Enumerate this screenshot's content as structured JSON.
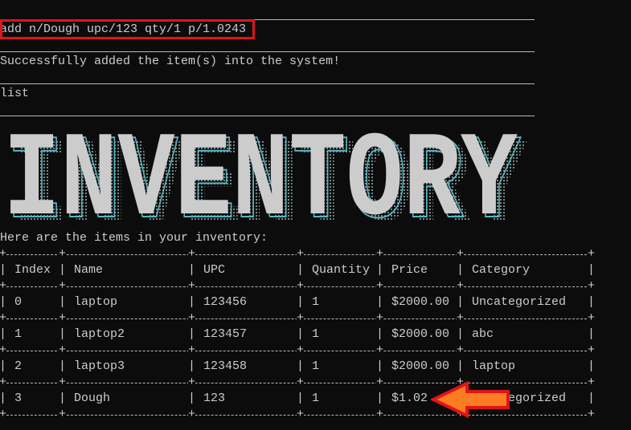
{
  "terminal": {
    "command": "add n/Dough upc/123 qty/1 p/1.0243",
    "response": "Successfully added the item(s) into the system!",
    "command2": "list",
    "banner": "INVENTORY",
    "intro": "Here are the items in your inventory:"
  },
  "table": {
    "headers": [
      "Index",
      "Name",
      "UPC",
      "Quantity",
      "Price",
      "Category"
    ],
    "rows": [
      [
        "0",
        "laptop",
        "123456",
        "1",
        "$2000.00",
        "Uncategorized"
      ],
      [
        "1",
        "laptop2",
        "123457",
        "1",
        "$2000.00",
        "abc"
      ],
      [
        "2",
        "laptop3",
        "123458",
        "1",
        "$2000.00",
        "laptop"
      ],
      [
        "3",
        "Dough",
        "123",
        "1",
        "$1.02",
        "Uncategorized"
      ]
    ]
  },
  "colors": {
    "highlight": "#e0141c",
    "arrow_fill": "#fd7b22"
  }
}
